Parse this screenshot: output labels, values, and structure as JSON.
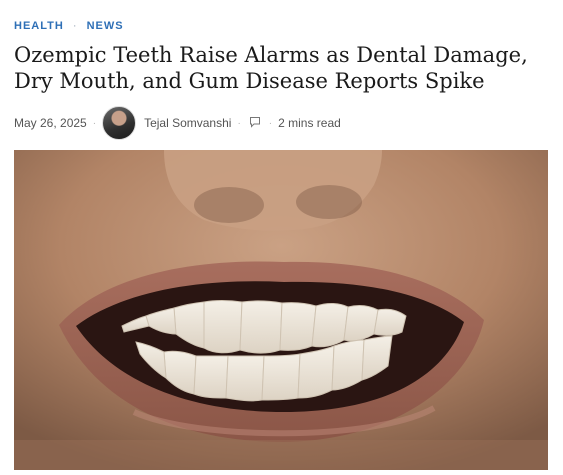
{
  "categories": [
    "HEALTH",
    "NEWS"
  ],
  "category_separator": "·",
  "headline": "Ozempic Teeth Raise Alarms as Dental Damage, Dry Mouth, and Gum Disease Reports Spike",
  "meta": {
    "date": "May 26, 2025",
    "author": "Tejal Somvanshi",
    "read_time": "2 mins read"
  },
  "icons": {
    "avatar": "author-avatar",
    "comment": "comment-icon"
  },
  "colors": {
    "category": "#2e6fb6",
    "headline": "#1a1a1a",
    "meta": "#555555"
  }
}
